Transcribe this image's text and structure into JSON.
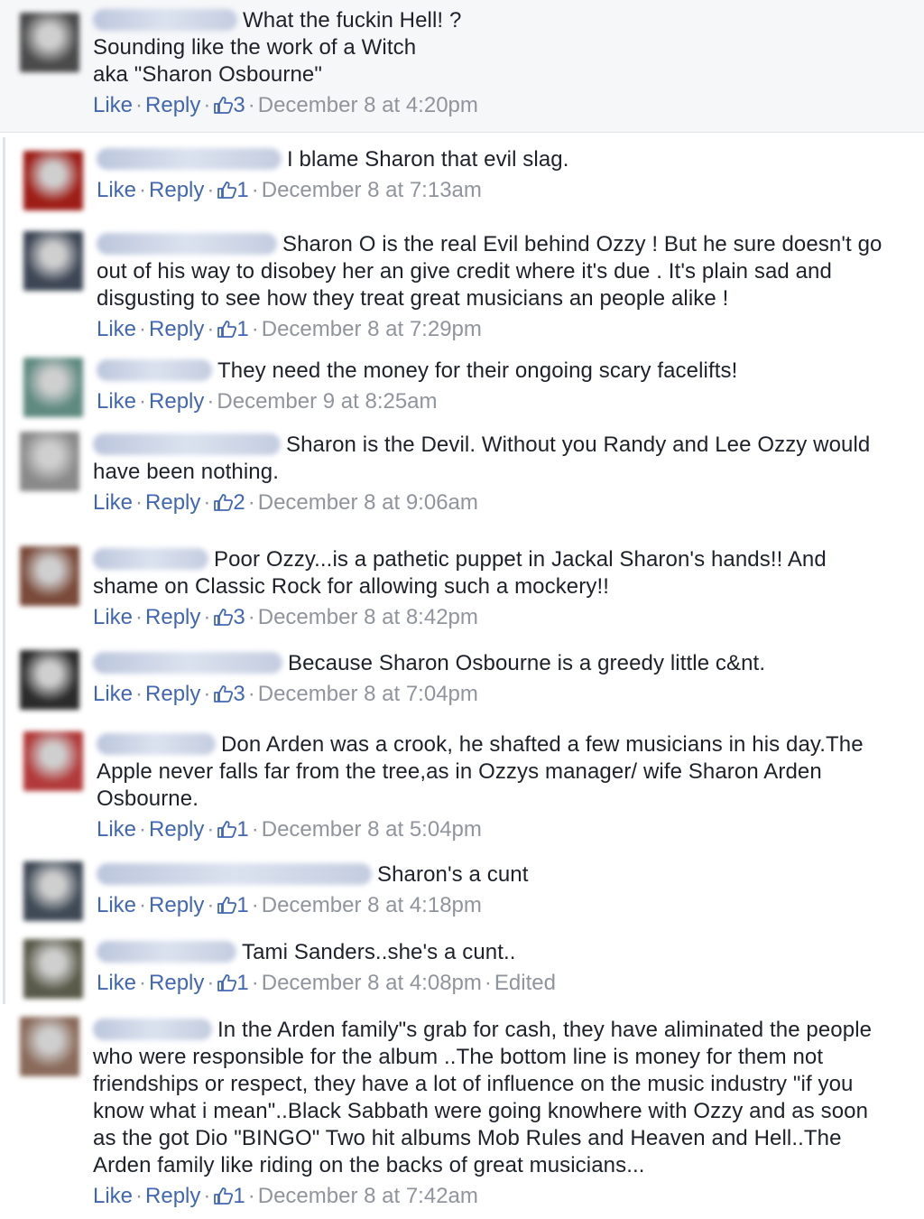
{
  "comments": [
    {
      "text_lines": [
        "What the fuckin Hell! ?",
        "Sounding like the work of a Witch",
        "aka \"Sharon Osbourne\""
      ],
      "like": "Like",
      "reply": "Reply",
      "likes": "3",
      "date": "December 8 at 4:20pm",
      "avatar_color": "#4b4b4b"
    },
    {
      "text_lines": [
        "I blame Sharon that evil slag."
      ],
      "like": "Like",
      "reply": "Reply",
      "likes": "1",
      "date": "December 8 at 7:13am",
      "avatar_color": "#9e1d17"
    },
    {
      "text_lines": [
        "Sharon O is the real Evil behind Ozzy ! But he sure doesn't go",
        "out of his way to disobey her an give credit where it's due . It's plain sad and",
        "disgusting to see how they treat great musicians an people alike !"
      ],
      "like": "Like",
      "reply": "Reply",
      "likes": "1",
      "date": "December 8 at 7:29pm",
      "avatar_color": "#3d4655"
    },
    {
      "text_lines": [
        "They need the money for their ongoing scary facelifts!"
      ],
      "like": "Like",
      "reply": "Reply",
      "likes": "",
      "date": "December 9 at 8:25am",
      "avatar_color": "#5f8a80"
    },
    {
      "text_lines": [
        "Sharon is the Devil. Without you Randy and Lee Ozzy would",
        "have been nothing."
      ],
      "like": "Like",
      "reply": "Reply",
      "likes": "2",
      "date": "December 8 at 9:06am",
      "avatar_color": "#8a8a8a"
    },
    {
      "text_lines": [
        "Poor Ozzy...is a pathetic puppet in Jackal Sharon's hands!! And",
        "shame on Classic Rock for allowing such a mockery!!"
      ],
      "like": "Like",
      "reply": "Reply",
      "likes": "3",
      "date": "December 8 at 8:42pm",
      "avatar_color": "#7a4a3a"
    },
    {
      "text_lines": [
        "Because Sharon Osbourne is a greedy little c&nt."
      ],
      "like": "Like",
      "reply": "Reply",
      "likes": "3",
      "date": "December 8 at 7:04pm",
      "avatar_color": "#2b2b2b"
    },
    {
      "text_lines": [
        "Don Arden was a crook, he shafted a few musicians in his day.The",
        "Apple never falls far from the tree,as in Ozzys manager/ wife Sharon Arden",
        "Osbourne."
      ],
      "like": "Like",
      "reply": "Reply",
      "likes": "1",
      "date": "December 8 at 5:04pm",
      "avatar_color": "#b23a3a"
    },
    {
      "text_lines": [
        "Sharon's a cunt"
      ],
      "like": "Like",
      "reply": "Reply",
      "likes": "1",
      "date": "December 8 at 4:18pm",
      "avatar_color": "#3f4a56"
    },
    {
      "text_lines": [
        "Tami Sanders..she's a cunt.."
      ],
      "like": "Like",
      "reply": "Reply",
      "likes": "1",
      "date": "December 8 at 4:08pm",
      "edited": "Edited",
      "avatar_color": "#5a5a4a"
    },
    {
      "text_lines": [
        "In the Arden family\"s grab for cash, they have aliminated the people",
        "who were responsible for the album ..The bottom line is money for them not",
        "friendships or respect, they have a lot of influence on the music industry \"if you",
        "know what i mean\"..Black Sabbath were going knowhere with Ozzy and as soon",
        "as the got Dio \"BINGO\" Two hit albums Mob Rules and Heaven and Hell..The",
        "Arden family like riding on the backs of great musicians..."
      ],
      "like": "Like",
      "reply": "Reply",
      "likes": "1",
      "date": "December 8 at 7:42am",
      "avatar_color": "#8a6a5a"
    }
  ]
}
